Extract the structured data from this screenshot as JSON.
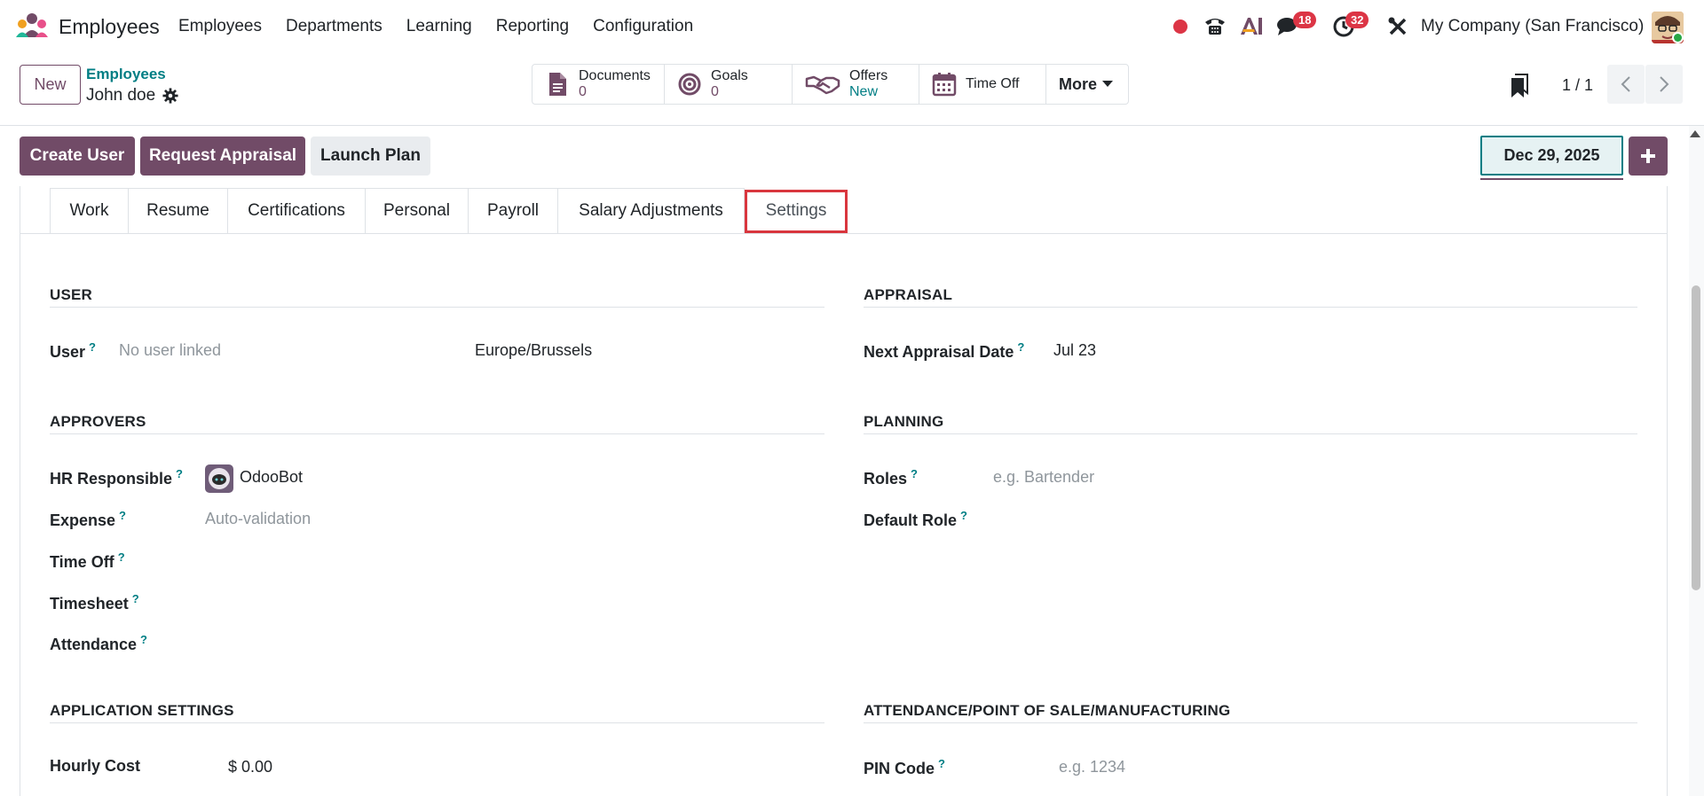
{
  "navbar": {
    "app_name": "Employees",
    "menu": [
      "Employees",
      "Departments",
      "Learning",
      "Reporting",
      "Configuration"
    ],
    "badges": {
      "chat": "18",
      "activity": "32"
    },
    "company": "My Company (San Francisco)"
  },
  "control": {
    "new_label": "New",
    "breadcrumb": "Employees",
    "record_name": "John doe",
    "smart_buttons": [
      {
        "label": "Documents",
        "value": "0"
      },
      {
        "label": "Goals",
        "value": "0"
      },
      {
        "label": "Offers",
        "value": "New"
      },
      {
        "label": "Time Off",
        "value": ""
      }
    ],
    "more_label": "More",
    "pager": "1 / 1"
  },
  "actions": {
    "create_user": "Create User",
    "request_appraisal": "Request Appraisal",
    "launch_plan": "Launch Plan",
    "date": "Dec 29, 2025"
  },
  "tabs": [
    "Work",
    "Resume",
    "Certifications",
    "Personal",
    "Payroll",
    "Salary Adjustments",
    "Settings"
  ],
  "settings": {
    "user": {
      "title": "USER",
      "label": "User",
      "placeholder": "No user linked",
      "timezone": "Europe/Brussels"
    },
    "appraisal": {
      "title": "APPRAISAL",
      "label": "Next Appraisal Date",
      "value": "Jul 23"
    },
    "approvers": {
      "title": "APPROVERS",
      "hr_label": "HR Responsible",
      "hr_value": "OdooBot",
      "expense_label": "Expense",
      "expense_placeholder": "Auto-validation",
      "timeoff_label": "Time Off",
      "timesheet_label": "Timesheet",
      "attendance_label": "Attendance"
    },
    "planning": {
      "title": "PLANNING",
      "roles_label": "Roles",
      "roles_placeholder": "e.g. Bartender",
      "default_role_label": "Default Role"
    },
    "application": {
      "title": "APPLICATION SETTINGS",
      "hourly_label": "Hourly Cost",
      "hourly_value": "$ 0.00"
    },
    "attendance_pos": {
      "title": "ATTENDANCE/POINT OF SALE/MANUFACTURING",
      "pin_label": "PIN Code",
      "pin_placeholder": "e.g. 1234"
    }
  },
  "help_mark": "?",
  "colors": {
    "primary": "#714b67",
    "teal": "#017e84",
    "highlight": "#d9363e"
  },
  "icons": [
    "employees-app-icon",
    "recording-icon",
    "phone-icon",
    "ai-icon",
    "chat-icon",
    "activity-clock-icon",
    "tools-icon",
    "gear-icon",
    "document-icon",
    "target-icon",
    "handshake-icon",
    "calendar-icon",
    "bookmark-icon",
    "chevron-left-icon",
    "chevron-right-icon",
    "plus-icon",
    "odoobot-icon"
  ]
}
